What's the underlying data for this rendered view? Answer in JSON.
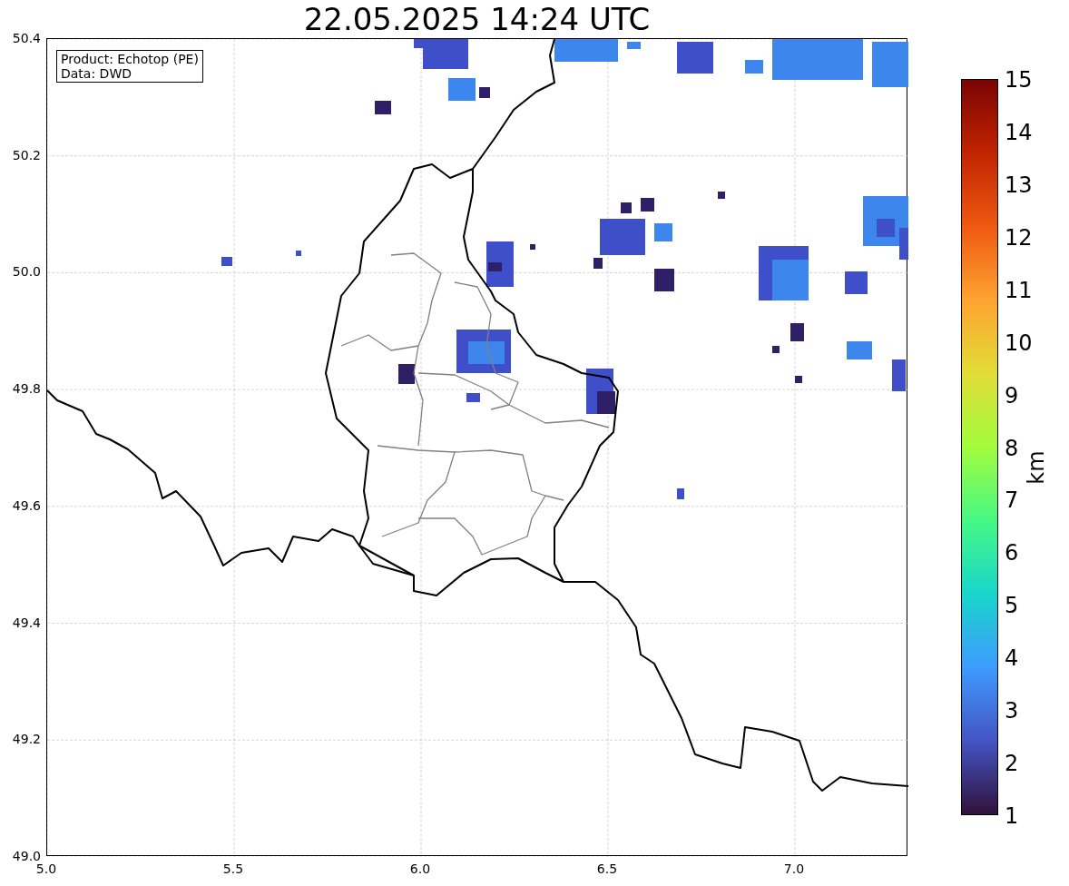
{
  "title": "22.05.2025 14:24 UTC",
  "info_box": [
    "Product: Echotop (PE)",
    "Data: DWD"
  ],
  "map": {
    "y_ticks": [
      "50.4",
      "50.2",
      "50.0",
      "49.8",
      "49.6",
      "49.4",
      "49.2",
      "49.0"
    ],
    "x_ticks": [
      "5.0",
      "5.5",
      "6.0",
      "6.5",
      "7.0"
    ]
  },
  "colorbar": {
    "label": "km",
    "ticks": [
      "15",
      "14",
      "13",
      "12",
      "11",
      "10",
      "9",
      "8",
      "7",
      "6",
      "5",
      "4",
      "3",
      "2",
      "1"
    ]
  }
}
